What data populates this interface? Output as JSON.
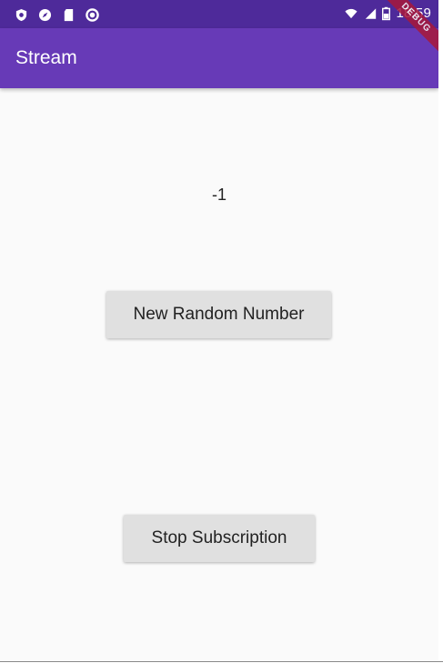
{
  "status_bar": {
    "time": "18:59",
    "left_icons": [
      "shield-icon",
      "navigation-icon",
      "sd-card-icon",
      "circle-icon"
    ],
    "right_icons": [
      "wifi-icon",
      "signal-icon",
      "battery-icon"
    ]
  },
  "app_bar": {
    "title": "Stream",
    "color": "#673ab7"
  },
  "debug_banner": {
    "label": "DEBUG",
    "color": "#a8183a"
  },
  "main": {
    "counter_value": "-1",
    "new_random_button_label": "New Random Number",
    "stop_subscription_button_label": "Stop Subscription"
  }
}
